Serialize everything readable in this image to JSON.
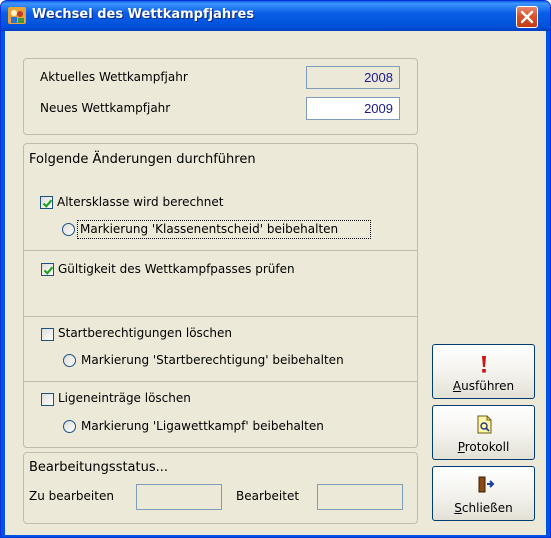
{
  "window": {
    "title": "Wechsel des Wettkampfjahres"
  },
  "years": {
    "current_label": "Aktuelles Wettkampfjahr",
    "current_value": "2008",
    "new_label": "Neues Wettkampfjahr",
    "new_value": "2009"
  },
  "changes": {
    "heading": "Folgende Änderungen durchführen",
    "altersklasse_label": "Altersklasse wird berechnet",
    "altersklasse_checked": true,
    "klassenentscheid_label": "Markierung 'Klassenentscheid' beibehalten",
    "gueltigkeit_label": "Gültigkeit des Wettkampfpasses prüfen",
    "gueltigkeit_checked": true,
    "start_label": "Startberechtigungen löschen",
    "start_checked": false,
    "startberechtigung_marker_label": "Markierung 'Startberechtigung' beibehalten",
    "liga_label": "Ligeneinträge löschen",
    "liga_checked": false,
    "ligawettkampf_marker_label": "Markierung 'Ligawettkampf' beibehalten"
  },
  "status": {
    "heading": "Bearbeitungsstatus...",
    "todo_label": "Zu bearbeiten",
    "todo_value": "",
    "done_label": "Bearbeitet",
    "done_value": ""
  },
  "buttons": {
    "execute": "Ausführen",
    "protocol": "Protokoll",
    "close": "Schließen"
  },
  "colors": {
    "titlebar": "#0054e3",
    "face": "#ece9d8",
    "value_text": "#1a1a8c"
  }
}
